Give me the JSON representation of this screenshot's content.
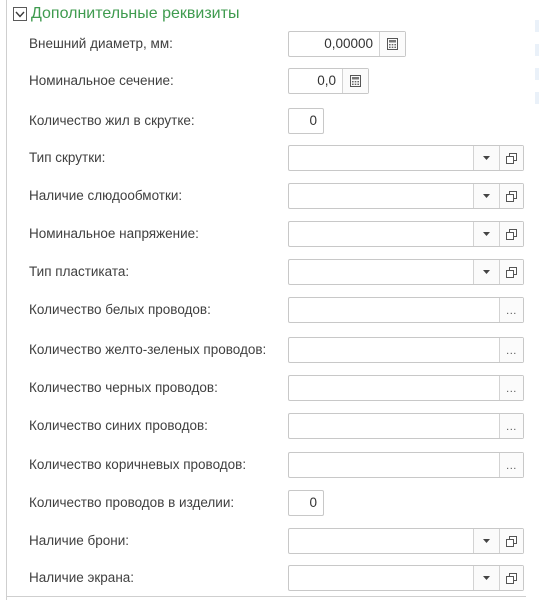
{
  "group": {
    "title": "Дополнительные реквизиты"
  },
  "fields": {
    "outer_diameter": {
      "label": "Внешний диаметр, мм:",
      "value": "0,00000"
    },
    "nominal_section": {
      "label": "Номинальное сечение:",
      "value": "0,0"
    },
    "cores_in_twist": {
      "label": "Количество жил в скрутке:",
      "value": "0"
    },
    "twist_type": {
      "label": "Тип скрутки:",
      "value": ""
    },
    "mica_wrap": {
      "label": "Наличие слюдообмотки:",
      "value": ""
    },
    "nominal_voltage": {
      "label": "Номинальное напряжение:",
      "value": ""
    },
    "plastic_type": {
      "label": "Тип пластиката:",
      "value": ""
    },
    "white_wires": {
      "label": "Количество белых проводов:",
      "value": ""
    },
    "yellow_green_wires": {
      "label": "Количество желто-зеленых проводов:",
      "value": ""
    },
    "black_wires": {
      "label": "Количество черных проводов:",
      "value": ""
    },
    "blue_wires": {
      "label": "Количество синих проводов:",
      "value": ""
    },
    "brown_wires": {
      "label": "Количество коричневых проводов:",
      "value": ""
    },
    "wires_in_product": {
      "label": "Количество проводов в изделии:",
      "value": "0"
    },
    "armor": {
      "label": "Наличие брони:",
      "value": ""
    },
    "screen": {
      "label": "Наличие экрана:",
      "value": ""
    }
  },
  "icons": {
    "collapse": "chevron-down-icon",
    "calculator": "calculator-icon",
    "dropdown": "dropdown-arrow-icon",
    "open": "open-form-icon",
    "select": "ellipsis-icon"
  },
  "colors": {
    "group_title": "#3f9b4f",
    "label_text": "#404040",
    "field_border": "#c8c8c8"
  }
}
